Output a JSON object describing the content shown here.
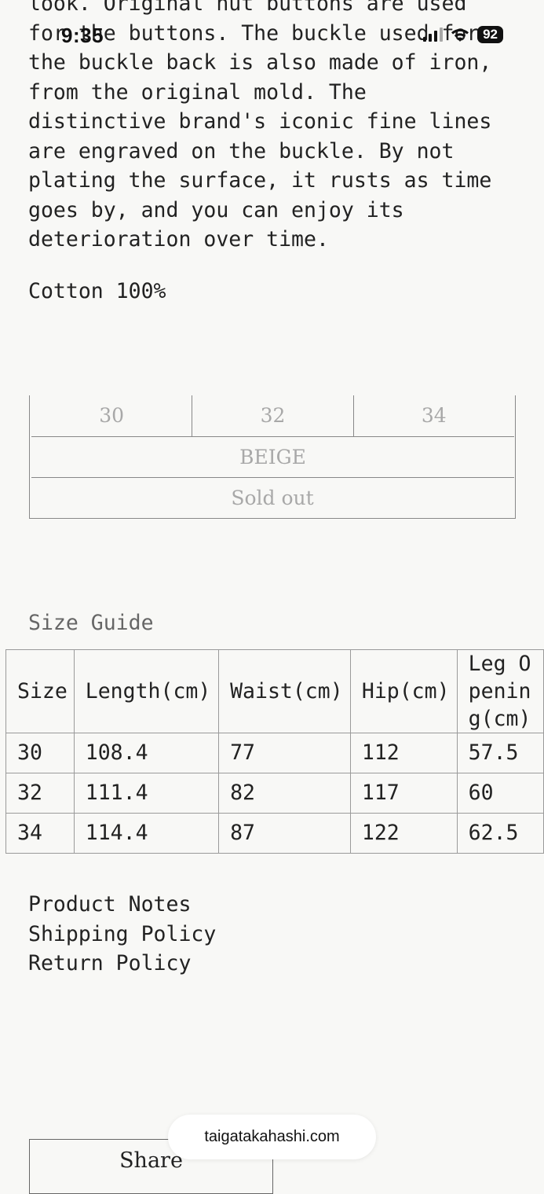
{
  "status_bar": {
    "time": "9:35",
    "battery": "92"
  },
  "description": {
    "text": "look. Original nut buttons are used\nfor the buttons. The buckle used for\nthe buckle back is also made of iron,\nfrom the original mold. The\ndistinctive brand's iconic fine lines\nare engraved on the buckle. By not\nplating the surface, it rusts as time\ngoes by, and you can enjoy its\ndeterioration over time."
  },
  "material": "Cotton 100%",
  "variant_selector": {
    "sizes": [
      "30",
      "32",
      "34"
    ],
    "color": "BEIGE",
    "stock_status": "Sold out"
  },
  "size_guide": {
    "title": "Size Guide",
    "headers": [
      "Size",
      "Length(cm)",
      "Waist(cm)",
      "Hip(cm)",
      "Leg Opening(cm)"
    ],
    "rows": [
      [
        "30",
        "108.4",
        "77",
        "112",
        "57.5"
      ],
      [
        "32",
        "111.4",
        "82",
        "117",
        "60"
      ],
      [
        "34",
        "114.4",
        "87",
        "122",
        "62.5"
      ]
    ]
  },
  "policy_links": [
    "Product Notes",
    "Shipping Policy",
    "Return Policy"
  ],
  "share_label": "Share",
  "browser_url": "taigatakahashi.com"
}
